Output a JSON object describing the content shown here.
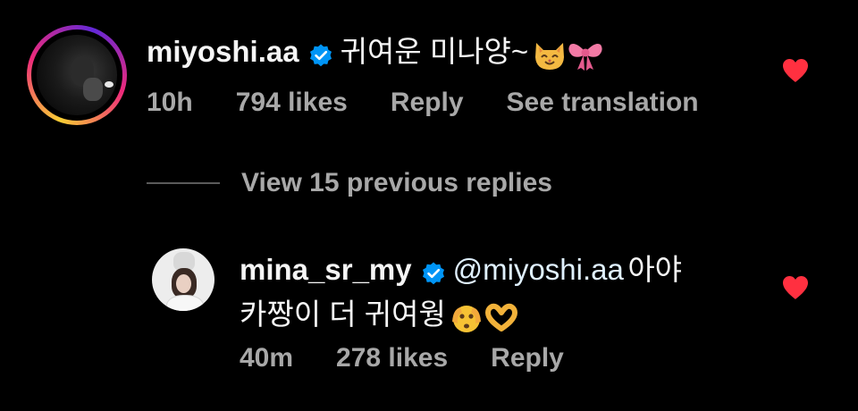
{
  "comment": {
    "username": "miyoshi.aa",
    "text": "귀여운 미나양~",
    "emojis": [
      "cat-face-icon",
      "ribbon-icon"
    ],
    "time": "10h",
    "likes": "794 likes",
    "reply_label": "Reply",
    "translate_label": "See translation",
    "liked": true
  },
  "view_replies": "View 15 previous replies",
  "reply": {
    "username": "mina_sr_my",
    "mention": "@miyoshi.aa",
    "text_line1": "아야",
    "text_line2": "카짱이 더 귀여웡",
    "emojis": [
      "face-peeking-icon",
      "heart-hands-icon"
    ],
    "time": "40m",
    "likes": "278 likes",
    "reply_label": "Reply",
    "liked": true
  },
  "colors": {
    "background": "#000000",
    "text": "#f5f5f5",
    "meta": "#a8a8a8",
    "verified": "#0095f6",
    "heart": "#ff3040"
  }
}
